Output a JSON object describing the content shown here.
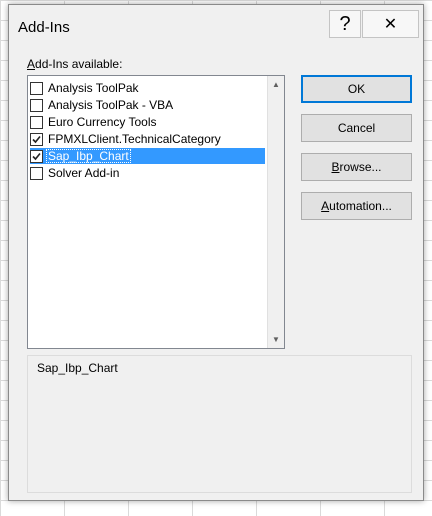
{
  "dialog": {
    "title": "Add-Ins"
  },
  "title_buttons": {
    "help_glyph": "?",
    "close_glyph": "✕"
  },
  "list": {
    "label_key": "A",
    "label_rest": "dd-Ins available:",
    "items": [
      {
        "label": "Analysis ToolPak",
        "checked": false,
        "selected": false
      },
      {
        "label": "Analysis ToolPak - VBA",
        "checked": false,
        "selected": false
      },
      {
        "label": "Euro Currency Tools",
        "checked": false,
        "selected": false
      },
      {
        "label": "FPMXLClient.TechnicalCategory",
        "checked": true,
        "selected": false
      },
      {
        "label": "Sap_Ibp_Chart",
        "checked": true,
        "selected": true
      },
      {
        "label": "Solver Add-in",
        "checked": false,
        "selected": false
      }
    ]
  },
  "buttons": {
    "ok": "OK",
    "cancel": "Cancel",
    "browse_key": "B",
    "browse_rest": "rowse...",
    "automation_key": "A",
    "automation_rest": "utomation..."
  },
  "description": {
    "title": "Sap_Ibp_Chart"
  },
  "colors": {
    "selection": "#3399ff",
    "default_button_border": "#0078d7",
    "dialog_bg": "#f0f0f0"
  }
}
